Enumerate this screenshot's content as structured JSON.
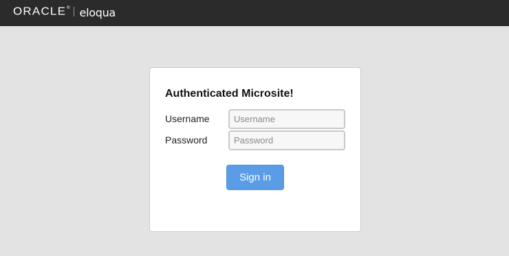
{
  "header": {
    "brand_oracle": "ORACLE",
    "brand_reg": "®",
    "brand_product": "eloqua"
  },
  "login": {
    "title": "Authenticated Microsite!",
    "username_label": "Username",
    "username_placeholder": "Username",
    "username_value": "",
    "password_label": "Password",
    "password_placeholder": "Password",
    "password_value": "",
    "signin_label": "Sign in"
  },
  "colors": {
    "topbar": "#2b2b2b",
    "page_background": "#e3e3e3",
    "button": "#5a9de6"
  }
}
